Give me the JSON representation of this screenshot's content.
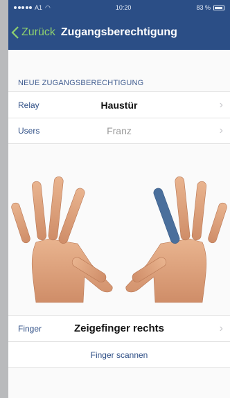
{
  "statusbar": {
    "carrier": "A1",
    "time": "10:20",
    "battery": "83 %"
  },
  "navbar": {
    "back_label": "Zurück",
    "title": "Zugangsberechtigung"
  },
  "section": {
    "header": "NEUE ZUGANGSBERECHTIGUNG"
  },
  "rows": {
    "relay": {
      "label": "Relay",
      "value": "Haustür"
    },
    "users": {
      "label": "Users",
      "value": "Franz"
    },
    "finger": {
      "label": "Finger",
      "value": "Zeigefinger rechts"
    }
  },
  "actions": {
    "scan_label": "Finger scannen"
  },
  "hands": {
    "selected_finger": "right-index",
    "highlight_color": "#4a6f9c"
  },
  "colors": {
    "nav_bg": "#2b4e86",
    "back_accent": "#8fd16f",
    "label_blue": "#2f4f86"
  }
}
